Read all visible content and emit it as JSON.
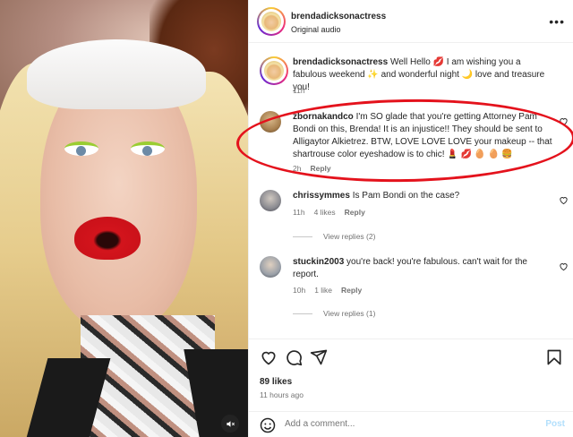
{
  "header": {
    "username": "brendadicksonactress",
    "subtitle": "Original audio",
    "more": "•••"
  },
  "caption": {
    "username": "brendadicksonactress",
    "text": "Well Hello 💋 I am wishing you a fabulous weekend ✨ and wonderful night 🌙 love and treasure you!",
    "time": "11h"
  },
  "comments": [
    {
      "username": "zbornakandco",
      "text": "I'm SO glade that you're getting Attorney Pam Bondi on this, Brenda! It is an injustice!! They should be sent to Alligaytor Alkietrez. BTW, LOVE LOVE LOVE your makeup -- that shartrouse color eyeshadow is to chic! 💄 💋 🥚 🥚 🍔",
      "time": "2h",
      "reply": "Reply"
    },
    {
      "username": "chrissymmes",
      "text": "Is Pam Bondi on the case?",
      "time": "11h",
      "likes": "4 likes",
      "reply": "Reply",
      "view_replies": "View replies (2)"
    },
    {
      "username": "stuckin2003",
      "text": "you're back! you're fabulous. can't wait for the report.",
      "time": "10h",
      "likes": "1 like",
      "reply": "Reply",
      "view_replies": "View replies (1)"
    }
  ],
  "actions": {
    "likes": "89 likes",
    "time_ago": "11 hours ago"
  },
  "add_comment": {
    "placeholder": "Add a comment...",
    "post": "Post"
  },
  "colors": {
    "highlight": "#e4121c",
    "post_disabled": "#b2dffc"
  },
  "icons": [
    "mute-icon",
    "more-icon",
    "heart-icon",
    "comment-icon",
    "share-icon",
    "bookmark-icon",
    "emoji-icon"
  ]
}
